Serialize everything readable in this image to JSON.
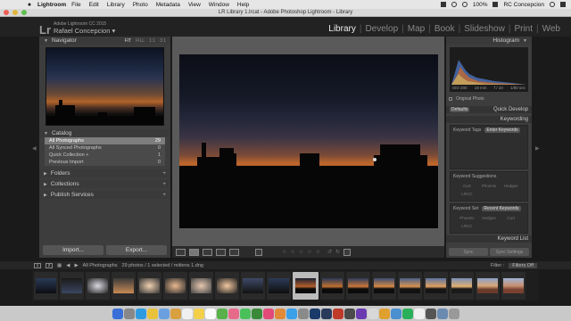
{
  "menubar": {
    "apple_icon": "",
    "app": "Lightroom",
    "items": [
      "File",
      "Edit",
      "Library",
      "Photo",
      "Metadata",
      "View",
      "Window",
      "Help"
    ],
    "battery": "100%",
    "user": "RC Concepcion"
  },
  "window": {
    "title": "LR Library 1.lrcat - Adobe Photoshop Lightroom - Library"
  },
  "lr_header": {
    "logo": "Lr",
    "version": "Adobe Lightroom CC 2015",
    "identity": "Rafael Concepcion",
    "modules": [
      "Library",
      "Develop",
      "Map",
      "Book",
      "Slideshow",
      "Print",
      "Web"
    ],
    "active_module": "Library"
  },
  "left_panel": {
    "navigator": {
      "title": "Navigator",
      "zoom_options": [
        "FIT",
        "FILL",
        "1:1",
        "3:1"
      ]
    },
    "catalog": {
      "title": "Catalog",
      "rows": [
        {
          "label": "All Photographs",
          "count": "29"
        },
        {
          "label": "All Synced Photographs",
          "count": "0"
        },
        {
          "label": "Quick Collection +",
          "count": "1"
        },
        {
          "label": "Previous Import",
          "count": "0"
        }
      ]
    },
    "sections": [
      "Folders",
      "Collections",
      "Publish Services"
    ],
    "import_label": "Import...",
    "export_label": "Export..."
  },
  "right_panel": {
    "histogram": {
      "title": "Histogram",
      "stats": [
        "ISO 200",
        "19 mm",
        "f / 10",
        "1/80 sec"
      ],
      "original_photo": "Original Photo"
    },
    "quick_develop": {
      "preset": "Defaults",
      "title": "Quick Develop"
    },
    "keywording": {
      "title": "Keywording",
      "tags_label": "Keyword Tags",
      "tags_value": "Enter Keywords",
      "suggestions_title": "Keyword Suggestions",
      "suggestions": [
        "Curt",
        "Phoenix",
        "Hedges",
        "LRCC"
      ],
      "set_label": "Keyword Set",
      "set_value": "Recent Keywords",
      "set_items": [
        "Phoenix",
        "Hedges",
        "Curt",
        "LRCC"
      ],
      "list_title": "Keyword List"
    },
    "sync_label": "Sync",
    "sync_settings_label": "Sync Settings"
  },
  "filmstrip_bar": {
    "page1": "1",
    "page2": "2",
    "source": "All Photographs",
    "info": "29 photos / 1 selected / mittens 1.dng",
    "filter_label": "Filter :",
    "filter_value": "Filters Off"
  },
  "colors": {
    "accent_active": "#eeeeee",
    "panel_bg": "#3d3d3d",
    "selected_row": "#7d7d7d"
  }
}
